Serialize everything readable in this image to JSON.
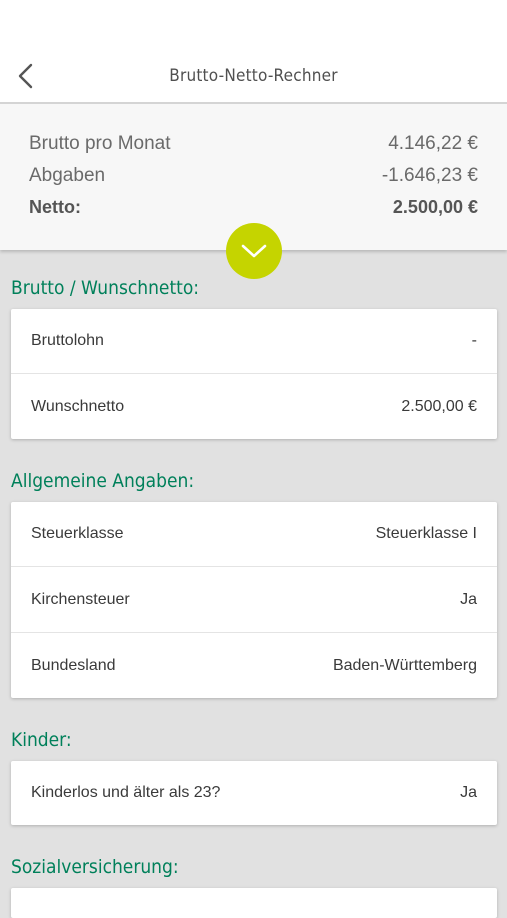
{
  "app_bar": {
    "title": "Brutto-Netto-Rechner",
    "back_icon": "chevron-left-icon"
  },
  "summary": {
    "rows": [
      {
        "label": "Brutto pro Monat",
        "value": "4.146,22 €"
      },
      {
        "label": "Abgaben",
        "value": "-1.646,23 €"
      },
      {
        "label": "Netto:",
        "value": "2.500,00 €"
      }
    ],
    "expand_icon": "chevron-down-icon",
    "accent_color": "#c5d400"
  },
  "sections": {
    "brutto": {
      "title": "Brutto / Wunschnetto:",
      "rows": [
        {
          "label": "Bruttolohn",
          "value": "-"
        },
        {
          "label": "Wunschnetto",
          "value": "2.500,00 €"
        }
      ]
    },
    "allgemein": {
      "title": "Allgemeine Angaben:",
      "rows": [
        {
          "label": "Steuerklasse",
          "value": "Steuerklasse I"
        },
        {
          "label": "Kirchensteuer",
          "value": "Ja"
        },
        {
          "label": "Bundesland",
          "value": "Baden-Württemberg"
        }
      ]
    },
    "kinder": {
      "title": "Kinder:",
      "rows": [
        {
          "label": "Kinderlos und älter als 23?",
          "value": "Ja"
        }
      ]
    },
    "sozial": {
      "title": "Sozialversicherung:"
    }
  },
  "colors": {
    "section_title": "#00805a",
    "background": "#e1e1e1"
  }
}
